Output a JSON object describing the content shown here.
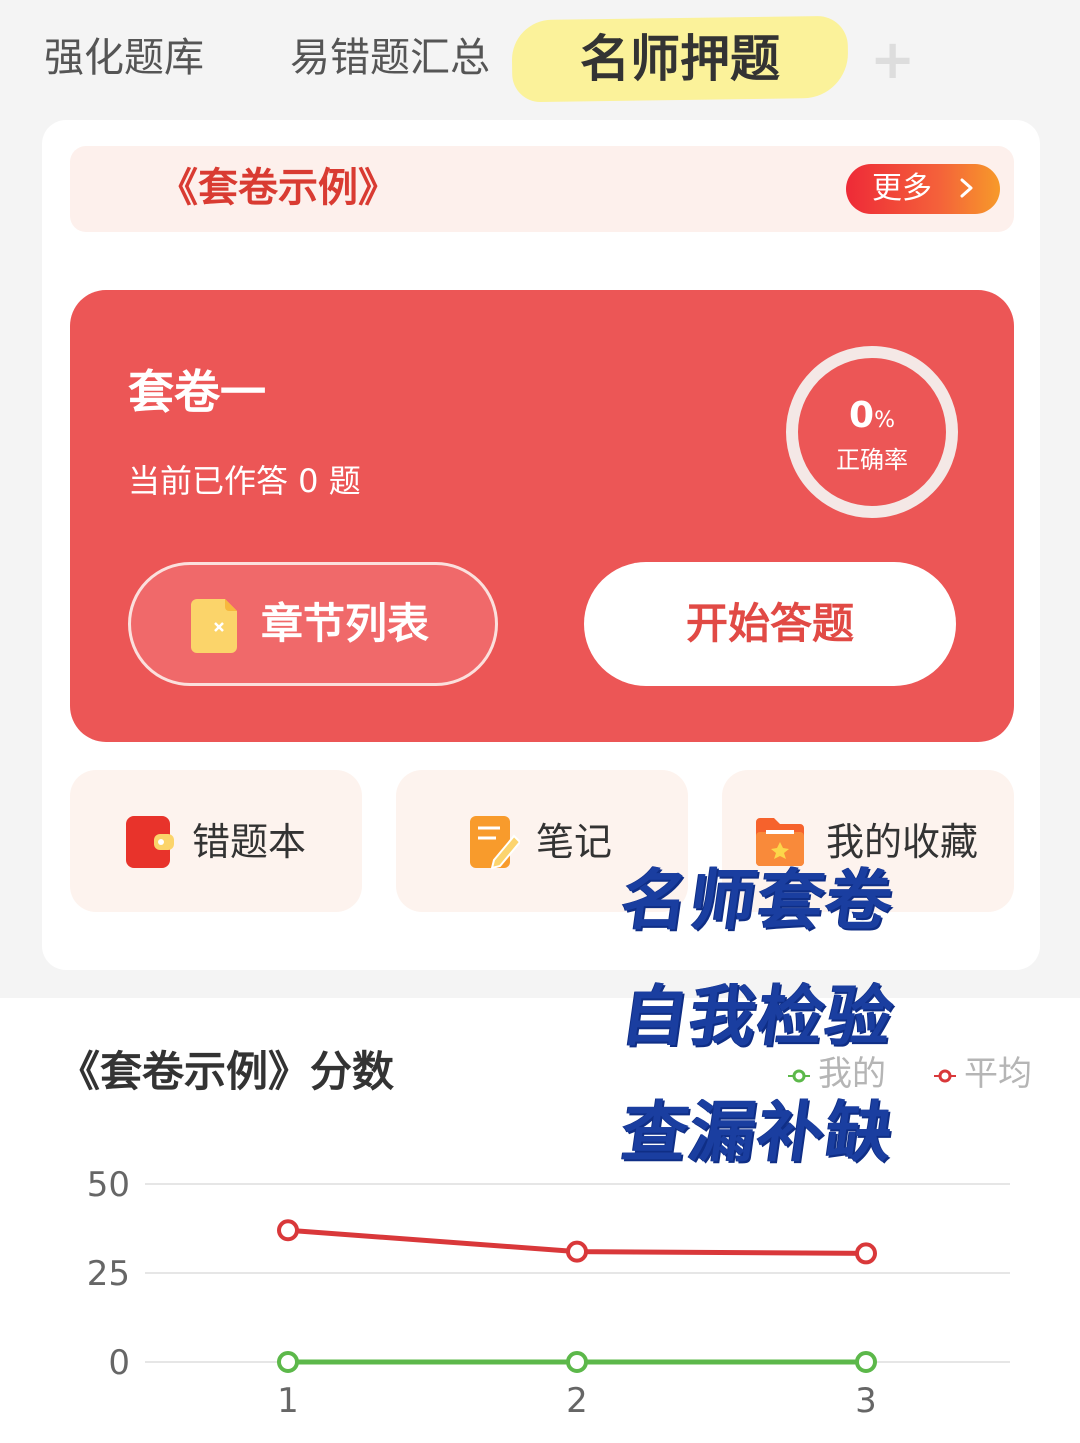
{
  "tabs": [
    {
      "label": "强化题库"
    },
    {
      "label": "易错题汇总"
    },
    {
      "label": "名师押题",
      "active": true
    }
  ],
  "tab_add_symbol": "+",
  "example": {
    "title": "《套卷示例》",
    "more_label": "更多"
  },
  "exam": {
    "name": "套卷一",
    "answered_text": "当前已作答 0 题",
    "accuracy_value": "0",
    "accuracy_unit": "%",
    "accuracy_label": "正确率",
    "chapter_button": "章节列表",
    "start_button": "开始答题"
  },
  "quick_links": [
    {
      "label": "错题本",
      "icon": "wrong-book-icon"
    },
    {
      "label": "笔记",
      "icon": "notes-icon"
    },
    {
      "label": "我的收藏",
      "icon": "favorites-folder-icon"
    }
  ],
  "overlay_text": [
    "名师套卷",
    "自我检验",
    "查漏补缺"
  ],
  "colors": {
    "accent_red": "#ec5656",
    "mine_series": "#5cb84a",
    "average_series": "#d9383a",
    "overlay_blue": "#1a3ea0",
    "tab_highlight": "#fbf29a"
  },
  "chart_data": {
    "type": "line",
    "title": "《套卷示例》分数",
    "x": [
      "1",
      "2",
      "3"
    ],
    "yticks": [
      "50",
      "25",
      "0"
    ],
    "ylim": [
      0,
      50
    ],
    "legend_placement": "top-right",
    "grid": true,
    "series": [
      {
        "name": "我的",
        "values": [
          0,
          0,
          0
        ],
        "color": "#5cb84a"
      },
      {
        "name": "平均",
        "values": [
          37,
          31,
          30.5
        ],
        "color": "#d9383a"
      }
    ]
  }
}
